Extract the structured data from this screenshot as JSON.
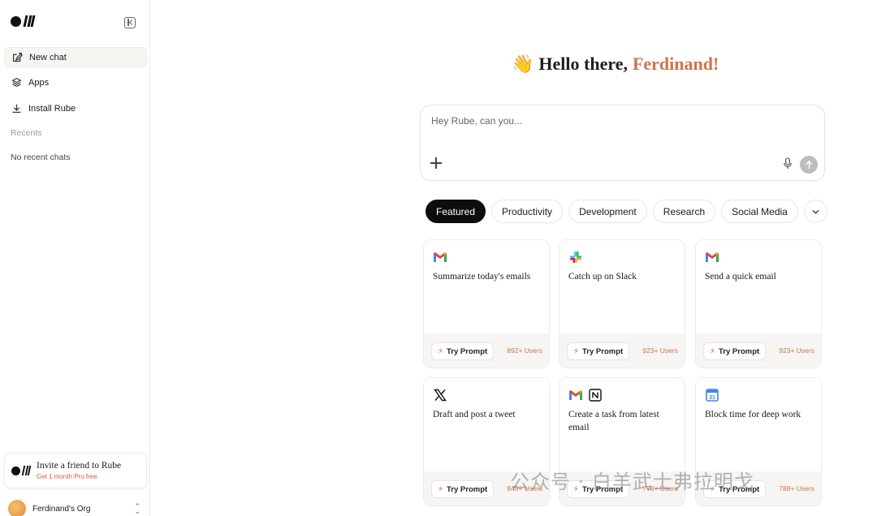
{
  "sidebar": {
    "collapse_icon": "sidebar-collapse-icon",
    "items": [
      {
        "label": "New chat",
        "icon": "edit-icon",
        "active": true
      },
      {
        "label": "Apps",
        "icon": "layers-icon",
        "active": false
      },
      {
        "label": "Install Rube",
        "icon": "download-icon",
        "active": false
      }
    ],
    "recents_label": "Recents",
    "empty_recents": "No recent chats",
    "invite": {
      "title": "Invite a friend to Rube",
      "subtitle": "Get 1 month Pro free."
    },
    "org": {
      "name": "Ferdinand's Org"
    }
  },
  "greeting": {
    "emoji": "👋",
    "text": "Hello there,",
    "name": "Ferdinand!"
  },
  "composer": {
    "placeholder": "Hey Rube, can you..."
  },
  "tabs": [
    {
      "label": "Featured",
      "active": true
    },
    {
      "label": "Productivity",
      "active": false
    },
    {
      "label": "Development",
      "active": false
    },
    {
      "label": "Research",
      "active": false
    },
    {
      "label": "Social Media",
      "active": false
    }
  ],
  "cards": [
    {
      "title": "Summarize today's emails",
      "icons": [
        "gmail-icon"
      ],
      "button": "Try Prompt",
      "users": "892+ Users"
    },
    {
      "title": "Catch up on Slack",
      "icons": [
        "slack-icon"
      ],
      "button": "Try Prompt",
      "users": "923+ Users"
    },
    {
      "title": "Send a quick email",
      "icons": [
        "gmail-icon"
      ],
      "button": "Try Prompt",
      "users": "923+ Users"
    },
    {
      "title": "Draft and post a tweet",
      "icons": [
        "x-icon"
      ],
      "button": "Try Prompt",
      "users": "845+ Users"
    },
    {
      "title": "Create a task from latest email",
      "icons": [
        "gmail-icon",
        "notion-icon"
      ],
      "button": "Try Prompt",
      "users": "778+ Users"
    },
    {
      "title": "Block time for deep work",
      "icons": [
        "google-calendar-icon"
      ],
      "button": "Try Prompt",
      "users": "788+ Users"
    }
  ],
  "watermark": "公众号 · 白羊武士弗拉明戈",
  "colors": {
    "accent": "#d0734a",
    "tab_active_bg": "#0d0d0d"
  }
}
